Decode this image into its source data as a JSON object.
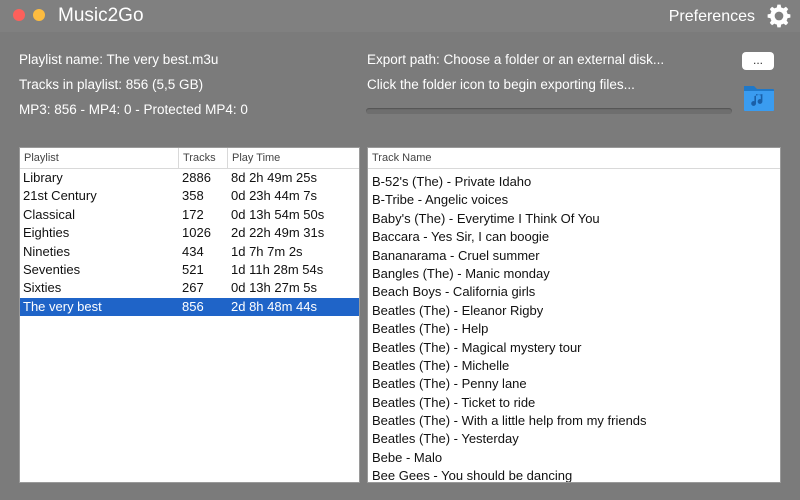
{
  "window": {
    "title": "Music2Go",
    "preferences_label": "Preferences"
  },
  "info": {
    "playlist_name": "Playlist name: The very best.m3u",
    "tracks_in_playlist": "Tracks in playlist: 856 (5,5 GB)",
    "format_counts": "MP3: 856 - MP4: 0 - Protected MP4: 0",
    "export_path": "Export path: Choose a folder or an external disk...",
    "export_hint": "Click the folder icon to begin exporting files...",
    "browse_label": "...",
    "export_progress": 0
  },
  "playlists": {
    "headers": [
      "Playlist",
      "Tracks",
      "Play Time"
    ],
    "rows": [
      {
        "name": "Library",
        "tracks": "2886",
        "time": "8d 2h 49m 25s"
      },
      {
        "name": "21st Century",
        "tracks": "358",
        "time": "0d 23h 44m 7s"
      },
      {
        "name": "Classical",
        "tracks": "172",
        "time": "0d 13h 54m 50s"
      },
      {
        "name": "Eighties",
        "tracks": "1026",
        "time": "2d 22h 49m 31s"
      },
      {
        "name": "Nineties",
        "tracks": "434",
        "time": "1d 7h 7m 2s"
      },
      {
        "name": "Seventies",
        "tracks": "521",
        "time": "1d 11h 28m 54s"
      },
      {
        "name": "Sixties",
        "tracks": "267",
        "time": "0d 13h 27m 5s"
      },
      {
        "name": "The very best",
        "tracks": "856",
        "time": "2d 8h 48m 44s",
        "selected": true
      }
    ]
  },
  "tracks": {
    "header": "Track Name",
    "rows": [
      "B-52's (The) - Private Idaho",
      "B-Tribe - Angelic voices",
      "Baby's (The) - Everytime I Think Of You",
      "Baccara - Yes Sir, I can boogie",
      "Bananarama - Cruel summer",
      "Bangles (The) - Manic monday",
      "Beach Boys - California girls",
      "Beatles (The) - Eleanor Rigby",
      "Beatles (The) - Help",
      "Beatles (The) - Magical mystery tour",
      "Beatles (The) - Michelle",
      "Beatles (The) - Penny lane",
      "Beatles (The) - Ticket to ride",
      "Beatles (The) - With a little help from my friends",
      "Beatles (The) - Yesterday",
      "Bebe - Malo",
      "Bee Gees - You should be dancing"
    ]
  },
  "colors": {
    "background": "#7b7b7b",
    "selection": "#1f64c8",
    "folder": "#2a8de0"
  },
  "icons": {
    "gear": "gear-icon",
    "folder": "music-folder-icon"
  }
}
